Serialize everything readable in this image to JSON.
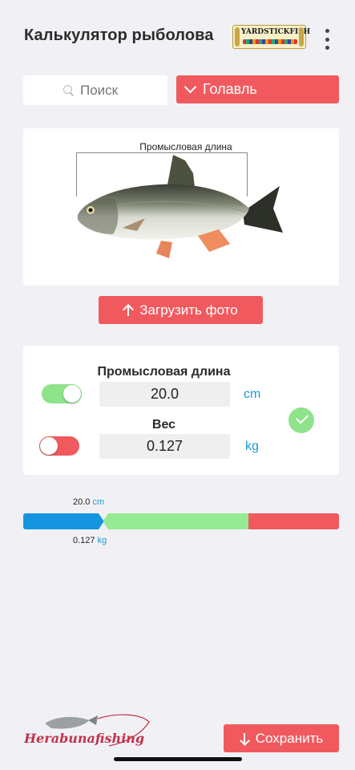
{
  "header": {
    "title": "Калькулятор рыболова",
    "logo_text": "YARDSTICKFISH",
    "menu_icon": "more-vertical-icon"
  },
  "search": {
    "placeholder": "Поиск",
    "icon": "search-icon"
  },
  "species": {
    "selected": "Голавль",
    "icon": "chevron-down-icon"
  },
  "fish_card": {
    "measure_label": "Промысловая длина"
  },
  "upload": {
    "label": "Загрузить фото",
    "icon": "arrow-up-icon"
  },
  "measurements": {
    "length": {
      "label": "Промысловая длина",
      "value": "20.0",
      "unit": "cm",
      "toggle_on": true
    },
    "weight": {
      "label": "Вес",
      "value": "0.127",
      "unit": "kg",
      "toggle_on": false
    },
    "valid_icon": "check-icon"
  },
  "scale": {
    "top_value": "20.0",
    "top_unit": "cm",
    "bottom_value": "0.127",
    "bottom_unit": "kg",
    "segments": [
      {
        "color": "#1595df",
        "fraction": 0.255
      },
      {
        "color": "#97ea94",
        "fraction": 0.457
      },
      {
        "color": "#f05a5f",
        "fraction": 0.288
      }
    ],
    "marker_fraction": 0.255
  },
  "footer": {
    "brand_logo": "Herabunafishing",
    "save_label": "Сохранить",
    "save_icon": "arrow-down-icon"
  },
  "colors": {
    "accent": "#f05a5f",
    "toggle_on": "#8ee38b",
    "unit_blue": "#1a9ad6",
    "background": "#f1f1f5"
  }
}
